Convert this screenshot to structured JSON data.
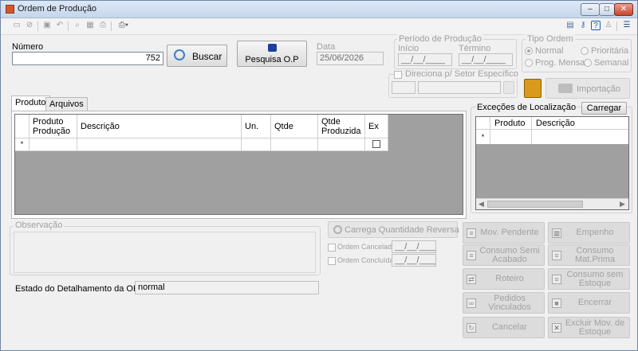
{
  "window": {
    "title": "Ordem de Produção",
    "controls": [
      "–",
      "□",
      "✕"
    ]
  },
  "numero": {
    "label": "Número",
    "value": "752"
  },
  "buttons": {
    "buscar": "Buscar",
    "pesquisa_op": "Pesquisa O.P",
    "importacao": "Importação",
    "carregar": "Carregar",
    "carrega_quantidade_reversa": "Carrega Quantidade Reversa"
  },
  "data": {
    "label": "Data",
    "value": "25/06/2026"
  },
  "periodo": {
    "title": "Período de Produção",
    "inicio_label": "Início",
    "termino_label": "Término",
    "inicio_value": "__/__/____",
    "termino_value": "__/__/____"
  },
  "tipo_ordem": {
    "title": "Tipo Ordem",
    "options": [
      "Normal",
      "Prioritária",
      "Prog. Mensal",
      "Semanal"
    ],
    "selected": "Normal"
  },
  "direciona": {
    "label": "Direciona p/ Setor Específico"
  },
  "tabs": [
    "Produto",
    "Arquivos"
  ],
  "produto_grid": {
    "columns": [
      "Produto Produção",
      "Descrição",
      "Un.",
      "Qtde",
      "Qtde Produzida",
      "Ex"
    ],
    "new_row_marker": "*"
  },
  "excecoes": {
    "title": "Exceções de Localização",
    "columns": [
      "Produto",
      "Descrição"
    ],
    "new_row_marker": "*"
  },
  "observacao": {
    "title": "Observação"
  },
  "ordem_cancelada": {
    "label": "Ordem Cancelada",
    "value": "__/__/____"
  },
  "ordem_concluida": {
    "label": "Ordem Concluída",
    "value": "__/__/____"
  },
  "estado": {
    "label": "Estado do Detalhamento da OP:",
    "value": "normal"
  },
  "side_buttons": [
    {
      "label": "Mov. Pendente",
      "icon": "list-icon"
    },
    {
      "label": "Empenho",
      "icon": "package-icon"
    },
    {
      "label": "Consumo Semi Acabado",
      "icon": "list-icon"
    },
    {
      "label": "Consumo Mat.Prima",
      "icon": "list-icon"
    },
    {
      "label": "Roteiro",
      "icon": "route-icon"
    },
    {
      "label": "Consumo sem Estoque",
      "icon": "list-icon"
    },
    {
      "label": "Pedidos Vinculados",
      "icon": "link-icon"
    },
    {
      "label": "Encerrar",
      "icon": "stop-icon"
    },
    {
      "label": "Cancelar",
      "icon": "cancel-icon"
    },
    {
      "label": "Excluir Mov. de Estoque",
      "icon": "delete-icon"
    }
  ]
}
